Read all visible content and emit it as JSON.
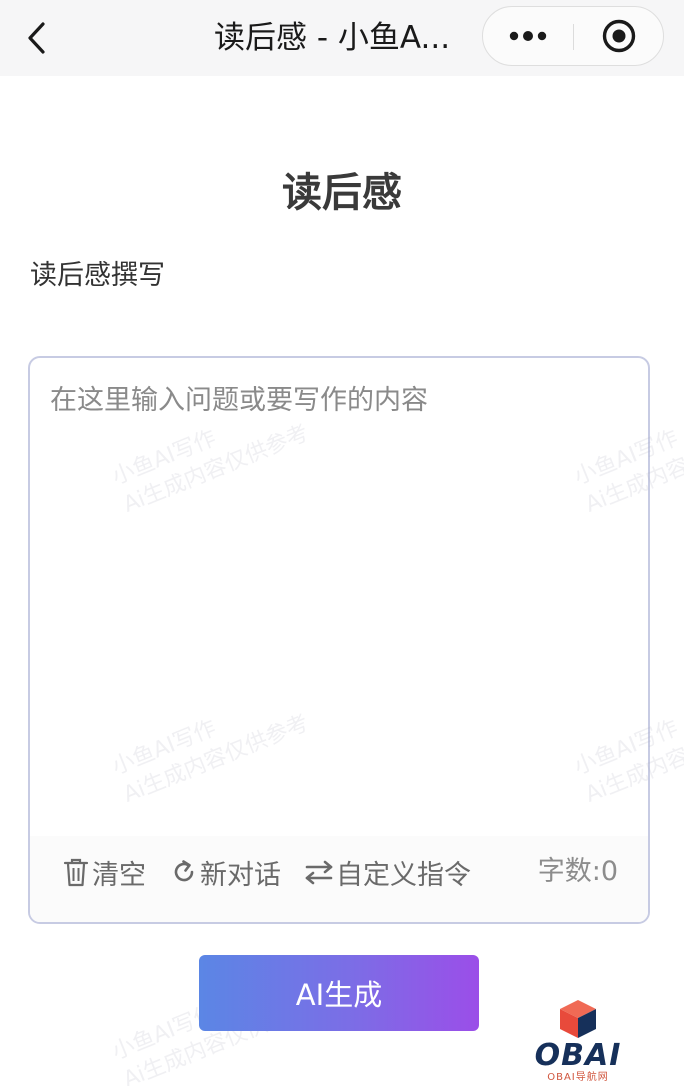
{
  "nav": {
    "title": "读后感 - 小鱼A...",
    "back_icon": "chevron-left-icon",
    "more_icon": "more-dots-icon",
    "close_icon": "record-circle-icon"
  },
  "page": {
    "title": "读后感",
    "subtitle": "读后感撰写"
  },
  "editor": {
    "placeholder": "在这里输入问题或要写作的内容",
    "value": "",
    "watermark_line1": "小鱼AI写作",
    "watermark_line2": "Ai生成内容仅供参考"
  },
  "toolbar": {
    "clear_label": "清空",
    "new_chat_label": "新对话",
    "custom_label": "自定义指令",
    "count_label": "字数:0"
  },
  "generate": {
    "label": "AI生成"
  },
  "logo": {
    "text": "OBAI",
    "sub": "OBAI导航网"
  },
  "colors": {
    "nav_bg": "#f6f6f7",
    "editor_border": "#c7cbe3",
    "button_start": "#5b86e5",
    "button_end": "#9b4ee8",
    "logo_red": "#e84a3b",
    "logo_navy": "#16305a"
  }
}
